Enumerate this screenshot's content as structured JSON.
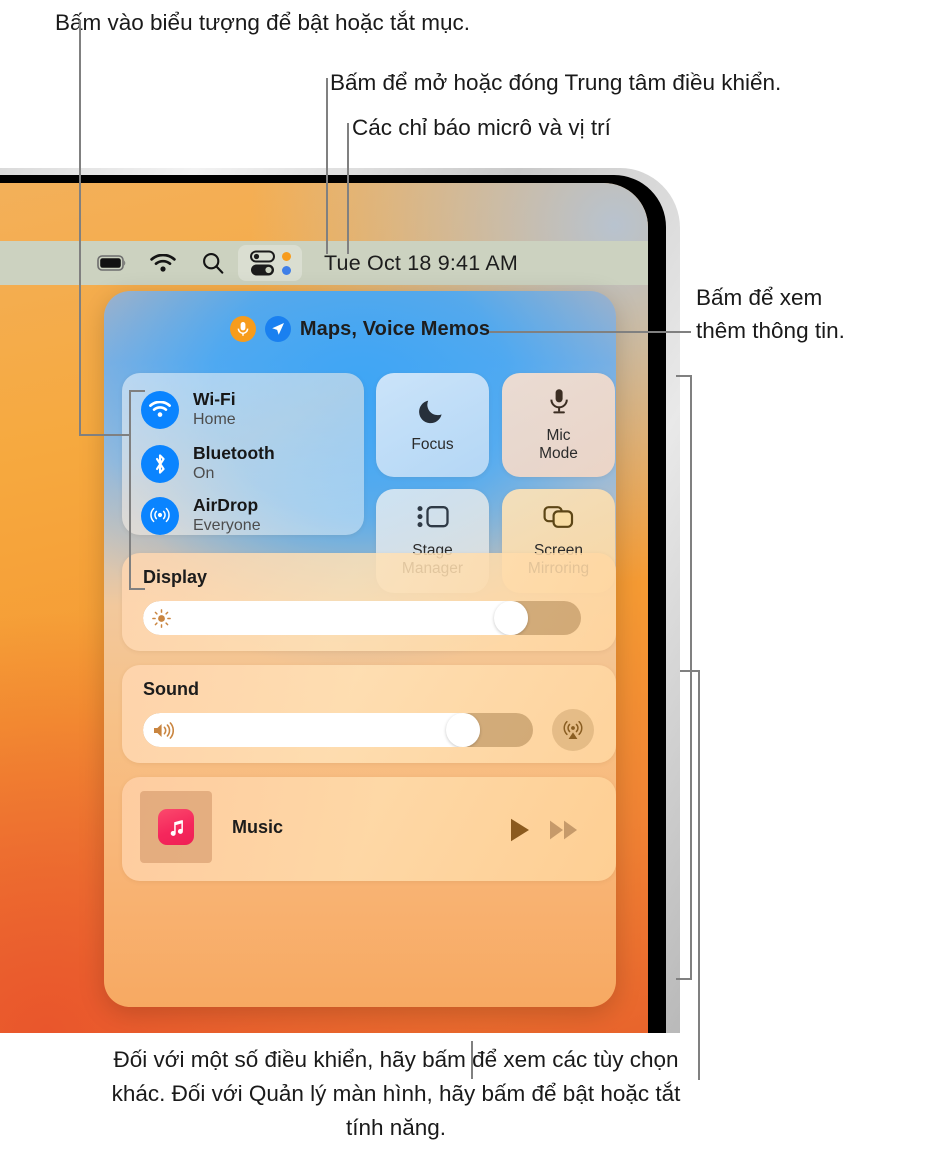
{
  "annotations": {
    "top_toggle": "Bấm vào biểu tượng để bật hoặc tắt mục.",
    "top_open_close": "Bấm để mở hoặc đóng Trung tâm điều khiển.",
    "top_indicators": "Các chỉ báo micrô và vị trí",
    "right_more_info": "Bấm để xem\nthêm thông tin.",
    "bottom_note": "Đối với một số điều khiển, hãy bấm để xem các tùy chọn khác. Đối với Quản lý màn hình, hãy bấm để bật hoặc tắt tính năng."
  },
  "menubar": {
    "icons": [
      "battery-icon",
      "wifi-icon",
      "search-icon",
      "control-center-icon"
    ],
    "indicator_dots": [
      "orange-dot",
      "blue-dot"
    ],
    "clock": "Tue Oct 18  9:41 AM"
  },
  "control_center": {
    "header": {
      "indicators": [
        "mic-indicator-icon",
        "location-indicator-icon"
      ],
      "label": "Maps, Voice Memos"
    },
    "connectivity": [
      {
        "icon": "wifi-icon",
        "title": "Wi-Fi",
        "status": "Home"
      },
      {
        "icon": "bluetooth-icon",
        "title": "Bluetooth",
        "status": "On"
      },
      {
        "icon": "airdrop-icon",
        "title": "AirDrop",
        "status": "Everyone"
      }
    ],
    "tiles": [
      {
        "icon": "moon-icon",
        "label": "Focus"
      },
      {
        "icon": "microphone-icon",
        "label": "Mic\nMode"
      },
      {
        "icon": "stage-manager-icon",
        "label": "Stage\nManager"
      },
      {
        "icon": "screen-mirroring-icon",
        "label": "Screen\nMirroring"
      }
    ],
    "display": {
      "label": "Display",
      "icon": "brightness-icon",
      "value": 88
    },
    "sound": {
      "label": "Sound",
      "icon": "speaker-icon",
      "value": 86,
      "airplay_icon": "airplay-audio-icon"
    },
    "music": {
      "app_icon": "music-app-icon",
      "title": "Music",
      "controls": [
        "play-icon",
        "fast-forward-icon"
      ]
    }
  },
  "colors": {
    "accent_blue": "#0a84ff",
    "mic_orange": "#f79c1c",
    "location_blue": "#1a80f0",
    "menubar": "#ccd2c0",
    "music_pink": "#f5275c",
    "annotation_line": "#808080"
  }
}
